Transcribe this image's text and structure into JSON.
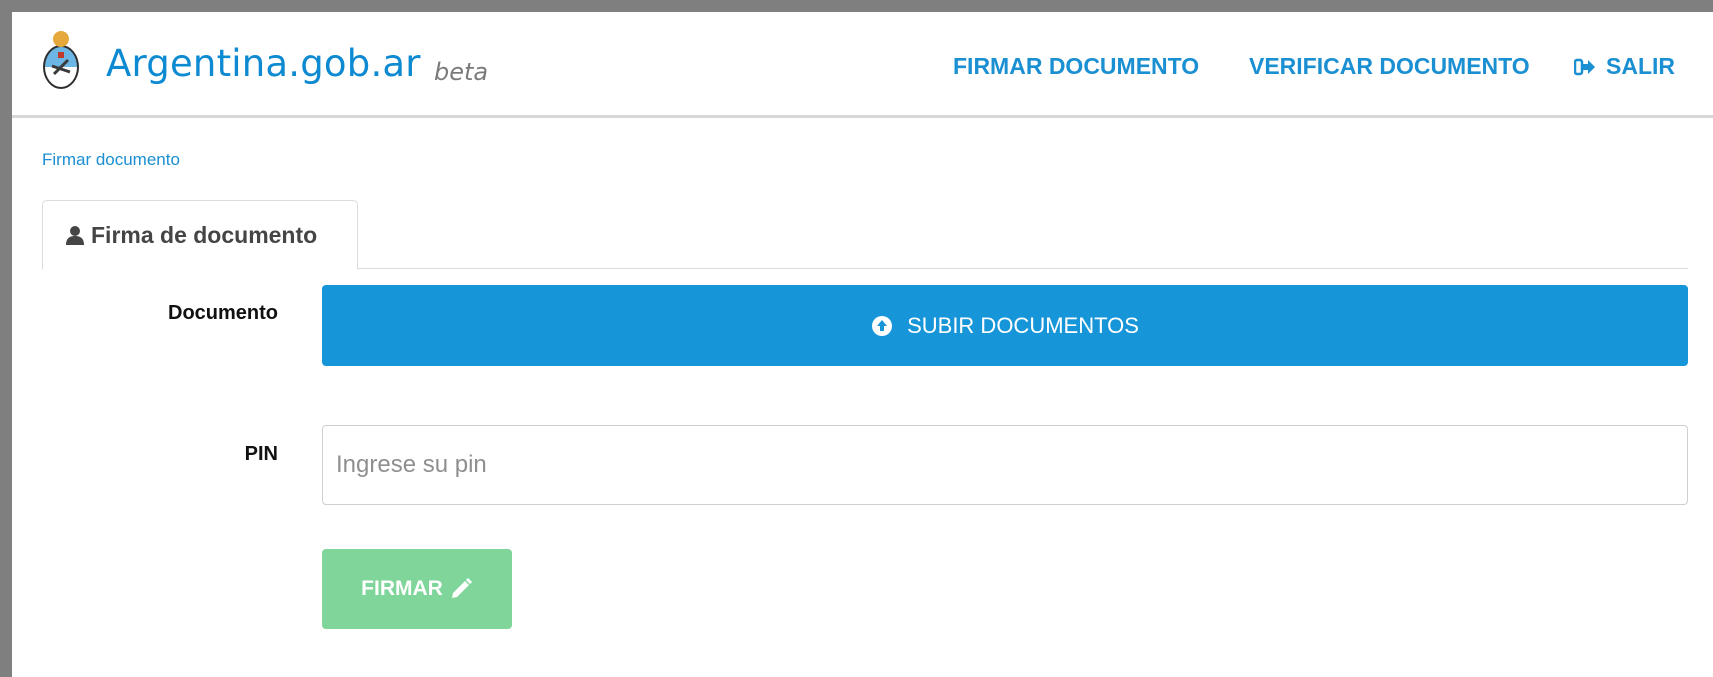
{
  "header": {
    "brand": "Argentina.gob.ar",
    "beta": "beta",
    "nav": {
      "firmar": "FIRMAR DOCUMENTO",
      "verificar": "VERIFICAR DOCUMENTO",
      "salir": "SALIR"
    }
  },
  "breadcrumb": "Firmar documento",
  "tab": {
    "label": "Firma de documento"
  },
  "form": {
    "documento_label": "Documento",
    "upload_label": "SUBIR DOCUMENTOS",
    "pin_label": "PIN",
    "pin_placeholder": "Ingrese su pin",
    "pin_value": "",
    "submit_label": "FIRMAR"
  },
  "colors": {
    "brand_blue": "#0d8ad1",
    "upload_blue": "#1795d9",
    "submit_green": "#7fd59a"
  },
  "icons": {
    "logo": "argentina-coat-of-arms-icon",
    "salir": "sign-out-icon",
    "tab": "user-icon",
    "upload": "circle-arrow-up-icon",
    "submit": "pencil-icon"
  }
}
